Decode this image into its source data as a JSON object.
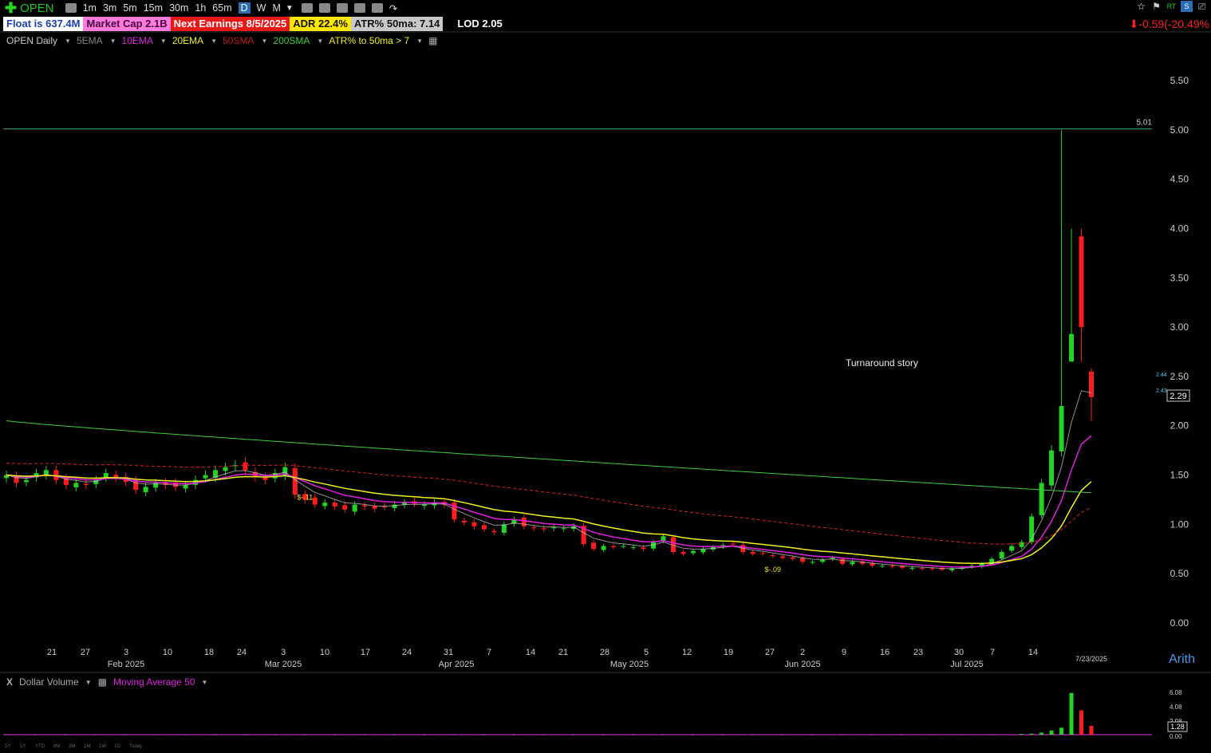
{
  "toolbar": {
    "symbol": "OPEN",
    "timeframes": [
      "1m",
      "3m",
      "5m",
      "15m",
      "30m",
      "1h",
      "65m",
      "D",
      "W",
      "M"
    ],
    "active_timeframe": "D"
  },
  "info": {
    "float": "Float is 637.4M",
    "market_cap": "Market Cap 2.1B",
    "next_earnings": "Next Earnings 8/5/2025",
    "adr": "ADR  22.4%",
    "atr": "ATR% 50ma:  7.14",
    "lod": "LOD 2.05",
    "change": "⬇-0.59(-20.49%"
  },
  "studies": {
    "main": "OPEN Daily",
    "ema5": "5EMA",
    "ema10": "10EMA",
    "ema20": "20EMA",
    "sma50": "50SMA",
    "sma200": "200SMA",
    "atr": "ATR% to 50ma > 7"
  },
  "volume_pane": {
    "close": "X",
    "label": "Dollar Volume",
    "ma_label": "Moving Average 50",
    "y_ticks": [
      "6.08",
      "4.08",
      "2.08",
      "0.00"
    ],
    "last_value": "1.28",
    "range_buttons": [
      "5Y",
      "1Y",
      "YTD",
      "6M",
      "3M",
      "1M",
      "1W",
      "1D",
      "Today"
    ]
  },
  "annotations": {
    "story": "Turnaround story",
    "earn1": "$-.11",
    "earn2": "$-.09",
    "hline": "5.01",
    "arith": "Arith",
    "last_date": "7/23/2025",
    "price_tag": "2.29",
    "tag_a": "2.44",
    "tag_b": "2.43"
  },
  "colors": {
    "up": "#22d322",
    "down": "#ff1c1c",
    "ema10": "#e020e0",
    "ema20": "#f0f020",
    "sma50": "#e02020",
    "sma200": "#3ccf3c",
    "ema5": "#d0d0d0"
  },
  "chart_data": {
    "type": "candlestick",
    "y_ticks": [
      5.5,
      5.0,
      4.5,
      4.0,
      3.5,
      3.0,
      2.5,
      2.0,
      1.5,
      1.0,
      0.5,
      0.0
    ],
    "ylim": [
      0,
      5.5
    ],
    "x_tick_labels": [
      "21",
      "27",
      "3",
      "10",
      "18",
      "24",
      "3",
      "10",
      "17",
      "24",
      "31",
      "7",
      "14",
      "21",
      "28",
      "5",
      "12",
      "19",
      "27",
      "2",
      "9",
      "16",
      "23",
      "30",
      "7",
      "14"
    ],
    "month_labels": [
      "Feb 2025",
      "Mar 2025",
      "Apr 2025",
      "May 2025",
      "Jun 2025",
      "Jul 2025"
    ],
    "horizontal_line": 5.01,
    "last_price": 2.29,
    "daily_closes": [
      1.5,
      1.42,
      1.45,
      1.52,
      1.55,
      1.45,
      1.4,
      1.42,
      1.4,
      1.45,
      1.52,
      1.48,
      1.43,
      1.35,
      1.38,
      1.42,
      1.4,
      1.38,
      1.4,
      1.45,
      1.5,
      1.55,
      1.58,
      1.6,
      1.55,
      1.48,
      1.45,
      1.52,
      1.58,
      1.3,
      1.25,
      1.2,
      1.22,
      1.18,
      1.15,
      1.2,
      1.18,
      1.16,
      1.18,
      1.2,
      1.22,
      1.21,
      1.2,
      1.22,
      1.2,
      1.05,
      1.02,
      0.98,
      0.95,
      0.92,
      1.0,
      1.05,
      0.98,
      0.96,
      0.95,
      0.97,
      0.96,
      0.98,
      0.8,
      0.75,
      0.78,
      0.77,
      0.78,
      0.77,
      0.75,
      0.82,
      0.88,
      0.72,
      0.7,
      0.73,
      0.75,
      0.77,
      0.79,
      0.8,
      0.72,
      0.7,
      0.7,
      0.68,
      0.66,
      0.65,
      0.62,
      0.62,
      0.64,
      0.66,
      0.6,
      0.62,
      0.6,
      0.58,
      0.58,
      0.57,
      0.56,
      0.56,
      0.55,
      0.55,
      0.54,
      0.55,
      0.56,
      0.58,
      0.6,
      0.65,
      0.72,
      0.78,
      0.82,
      1.08,
      1.42,
      1.75,
      2.2,
      2.93,
      3.0,
      2.29
    ],
    "sma200": [
      2.05,
      1.32
    ],
    "volume_last_days": [
      0.1,
      0.15,
      0.3,
      0.6,
      1.0,
      6.0,
      3.5,
      1.28
    ]
  }
}
